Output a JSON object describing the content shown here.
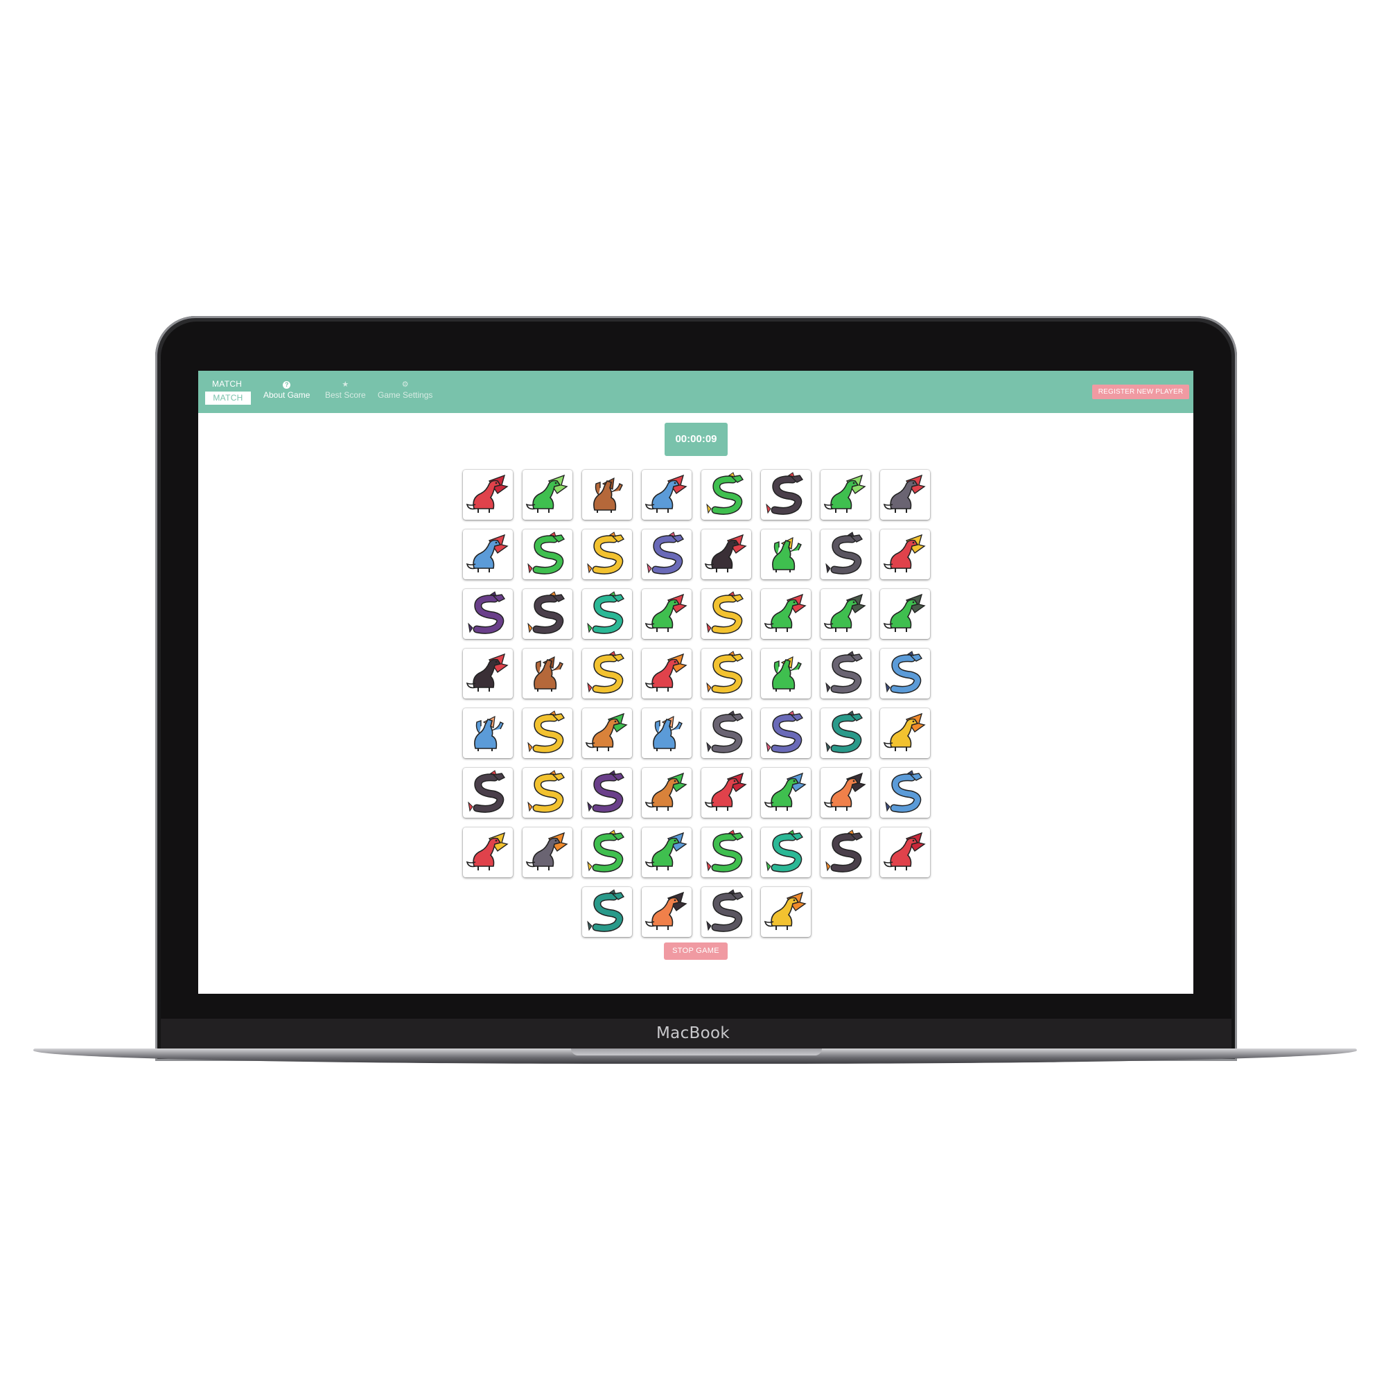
{
  "device": {
    "brand": "MacBook"
  },
  "navbar": {
    "logo_top": "MATCH",
    "logo_button": "MATCH",
    "items": [
      {
        "label": "About Game",
        "icon": "question-icon",
        "active": true
      },
      {
        "label": "Best Score",
        "icon": "star-icon",
        "active": false
      },
      {
        "label": "Game Settings",
        "icon": "gear-icon",
        "active": false
      }
    ],
    "register_label": "REGISTER NEW PLAYER"
  },
  "timer": {
    "value": "00:00:09"
  },
  "board": {
    "columns": 8,
    "cards": [
      {
        "type": "winged",
        "body": "#e0424b",
        "wing": "#c9283a"
      },
      {
        "type": "winged",
        "body": "#3fbf4f",
        "wing": "#8fdc6a"
      },
      {
        "type": "multihead",
        "body": "#b5683a",
        "wing": "#9a522a"
      },
      {
        "type": "winged",
        "body": "#5b9bd8",
        "wing": "#e0424b"
      },
      {
        "type": "serpent",
        "body": "#3fbf4f",
        "wing": "#f2c230"
      },
      {
        "type": "serpent",
        "body": "#4a3f4a",
        "wing": "#e0424b"
      },
      {
        "type": "winged",
        "body": "#3fbf4f",
        "wing": "#8fdc6a"
      },
      {
        "type": "winged",
        "body": "#6a6472",
        "wing": "#e0424b"
      },
      {
        "type": "winged",
        "body": "#5b9bd8",
        "wing": "#e0424b"
      },
      {
        "type": "serpent",
        "body": "#3fbf4f",
        "wing": "#e0424b"
      },
      {
        "type": "serpent",
        "body": "#f2c230",
        "wing": "#f08a2c"
      },
      {
        "type": "serpent",
        "body": "#6a6ab8",
        "wing": "#e05a7a"
      },
      {
        "type": "winged",
        "body": "#3a2f36",
        "wing": "#e0424b"
      },
      {
        "type": "multihead",
        "body": "#3fbf4f",
        "wing": "#f2c230"
      },
      {
        "type": "serpent",
        "body": "#5a5560",
        "wing": "#3a3540"
      },
      {
        "type": "winged",
        "body": "#e0424b",
        "wing": "#f2c230"
      },
      {
        "type": "serpent",
        "body": "#6a3f8a",
        "wing": "#4a2f66"
      },
      {
        "type": "serpent",
        "body": "#4a3f4a",
        "wing": "#f08a2c"
      },
      {
        "type": "serpent",
        "body": "#2bb896",
        "wing": "#3fbf4f"
      },
      {
        "type": "winged",
        "body": "#3fbf4f",
        "wing": "#e0424b"
      },
      {
        "type": "serpent",
        "body": "#f2c230",
        "wing": "#e0424b"
      },
      {
        "type": "winged",
        "body": "#3fbf4f",
        "wing": "#e0424b"
      },
      {
        "type": "winged",
        "body": "#3fbf4f",
        "wing": "#4a5a4a"
      },
      {
        "type": "winged",
        "body": "#3fbf4f",
        "wing": "#4a5a4a"
      },
      {
        "type": "winged",
        "body": "#3a2f36",
        "wing": "#e0424b"
      },
      {
        "type": "multihead",
        "body": "#b5683a",
        "wing": "#9a522a"
      },
      {
        "type": "serpent",
        "body": "#f2c230",
        "wing": "#e0424b"
      },
      {
        "type": "winged",
        "body": "#e0424b",
        "wing": "#f08a2c"
      },
      {
        "type": "serpent",
        "body": "#f2c230",
        "wing": "#f08a2c"
      },
      {
        "type": "multihead",
        "body": "#3fbf4f",
        "wing": "#f2c230"
      },
      {
        "type": "serpent",
        "body": "#6a6472",
        "wing": "#4a4450"
      },
      {
        "type": "serpent",
        "body": "#5b9bd8",
        "wing": "#3a4a78"
      },
      {
        "type": "multihead",
        "body": "#5b9bd8",
        "wing": "#f0a070"
      },
      {
        "type": "serpent",
        "body": "#f2c230",
        "wing": "#f08a2c"
      },
      {
        "type": "winged",
        "body": "#d9823a",
        "wing": "#3fbf4f"
      },
      {
        "type": "multihead",
        "body": "#5b9bd8",
        "wing": "#f0a070"
      },
      {
        "type": "serpent",
        "body": "#6a6472",
        "wing": "#4a4450"
      },
      {
        "type": "serpent",
        "body": "#6a6ab8",
        "wing": "#e05a7a"
      },
      {
        "type": "serpent",
        "body": "#2a9a8a",
        "wing": "#3a5a5a"
      },
      {
        "type": "winged",
        "body": "#f2c230",
        "wing": "#f08a2c"
      },
      {
        "type": "serpent",
        "body": "#4a3f4a",
        "wing": "#e0424b"
      },
      {
        "type": "serpent",
        "body": "#f2c230",
        "wing": "#f08a2c"
      },
      {
        "type": "serpent",
        "body": "#6a3f8a",
        "wing": "#4a2f66"
      },
      {
        "type": "winged",
        "body": "#d9823a",
        "wing": "#3fbf4f"
      },
      {
        "type": "winged",
        "body": "#e0424b",
        "wing": "#c9283a"
      },
      {
        "type": "winged",
        "body": "#3fbf4f",
        "wing": "#5b9bd8"
      },
      {
        "type": "winged",
        "body": "#f0804a",
        "wing": "#3a2f36"
      },
      {
        "type": "serpent",
        "body": "#5b9bd8",
        "wing": "#3a4a78"
      },
      {
        "type": "winged",
        "body": "#e0424b",
        "wing": "#f2c230"
      },
      {
        "type": "winged",
        "body": "#6a6472",
        "wing": "#f08a2c"
      },
      {
        "type": "serpent",
        "body": "#3fbf4f",
        "wing": "#f2c230"
      },
      {
        "type": "winged",
        "body": "#3fbf4f",
        "wing": "#5b9bd8"
      },
      {
        "type": "serpent",
        "body": "#3fbf4f",
        "wing": "#e0424b"
      },
      {
        "type": "serpent",
        "body": "#2bb896",
        "wing": "#3fbf4f"
      },
      {
        "type": "serpent",
        "body": "#4a3f4a",
        "wing": "#f08a2c"
      },
      {
        "type": "winged",
        "body": "#e0424b",
        "wing": "#c9283a"
      },
      {
        "type": "serpent",
        "body": "#2a9a8a",
        "wing": "#3a5a5a"
      },
      {
        "type": "winged",
        "body": "#f0804a",
        "wing": "#3a2f36"
      },
      {
        "type": "serpent",
        "body": "#5a5560",
        "wing": "#3a3540"
      },
      {
        "type": "winged",
        "body": "#f2c230",
        "wing": "#f08a2c"
      }
    ]
  },
  "stop_label": "STOP GAME",
  "colors": {
    "accent": "#79c2ab",
    "danger": "#f09aa2"
  }
}
